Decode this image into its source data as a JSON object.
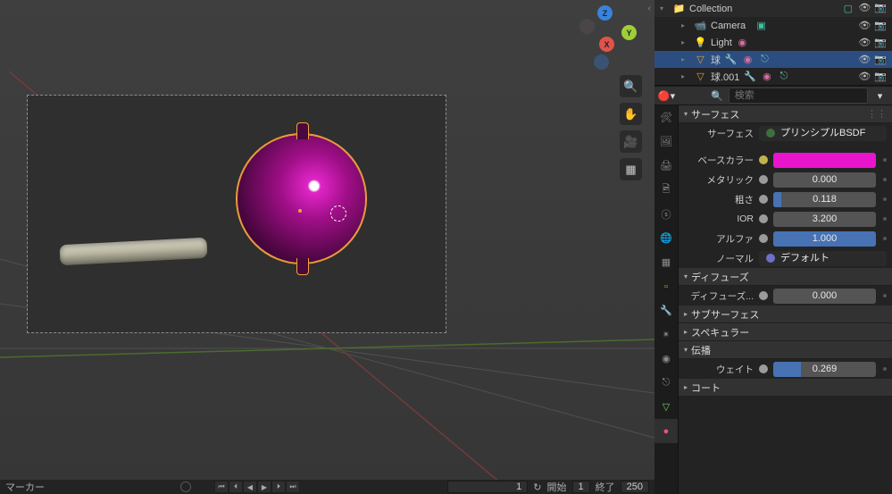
{
  "outliner": {
    "collection_label": "Collection",
    "items": [
      {
        "name": "Camera",
        "icon": "📹",
        "mods": []
      },
      {
        "name": "Light",
        "icon": "💡",
        "mods": [
          "phy"
        ]
      },
      {
        "name": "球",
        "icon": "▽",
        "mods": [
          "wr",
          "phy",
          "con"
        ],
        "selected": true
      },
      {
        "name": "球.001",
        "icon": "▽",
        "mods": [
          "wr",
          "phy",
          "con"
        ]
      }
    ]
  },
  "search": {
    "placeholder": "検索"
  },
  "surface": {
    "section": "サーフェス",
    "surface_label": "サーフェス",
    "shader": "プリンシプルBSDF",
    "base_color_label": "ベースカラー",
    "metallic_label": "メタリック",
    "metallic": "0.000",
    "rough_label": "粗さ",
    "rough": "0.118",
    "rough_pct": 8,
    "ior_label": "IOR",
    "ior": "3.200",
    "alpha_label": "アルファ",
    "alpha": "1.000",
    "alpha_pct": 100,
    "normal_label": "ノーマル",
    "normal": "デフォルト"
  },
  "diffuse": {
    "section": "ディフューズ",
    "rough_label": "ディフューズ...",
    "rough": "0.000"
  },
  "sections": {
    "subsurface": "サブサーフェス",
    "specular": "スペキュラー",
    "transmit": "伝播",
    "weight_label": "ウェイト",
    "weight": "0.269",
    "weight_pct": 27,
    "coat": "コート"
  },
  "timeline": {
    "marker": "マーカー",
    "frame": "1",
    "start_label": "開始",
    "start": "1",
    "end_label": "終了",
    "end": "250"
  },
  "gizmo": {
    "x": "X",
    "y": "Y",
    "z": "Z"
  }
}
